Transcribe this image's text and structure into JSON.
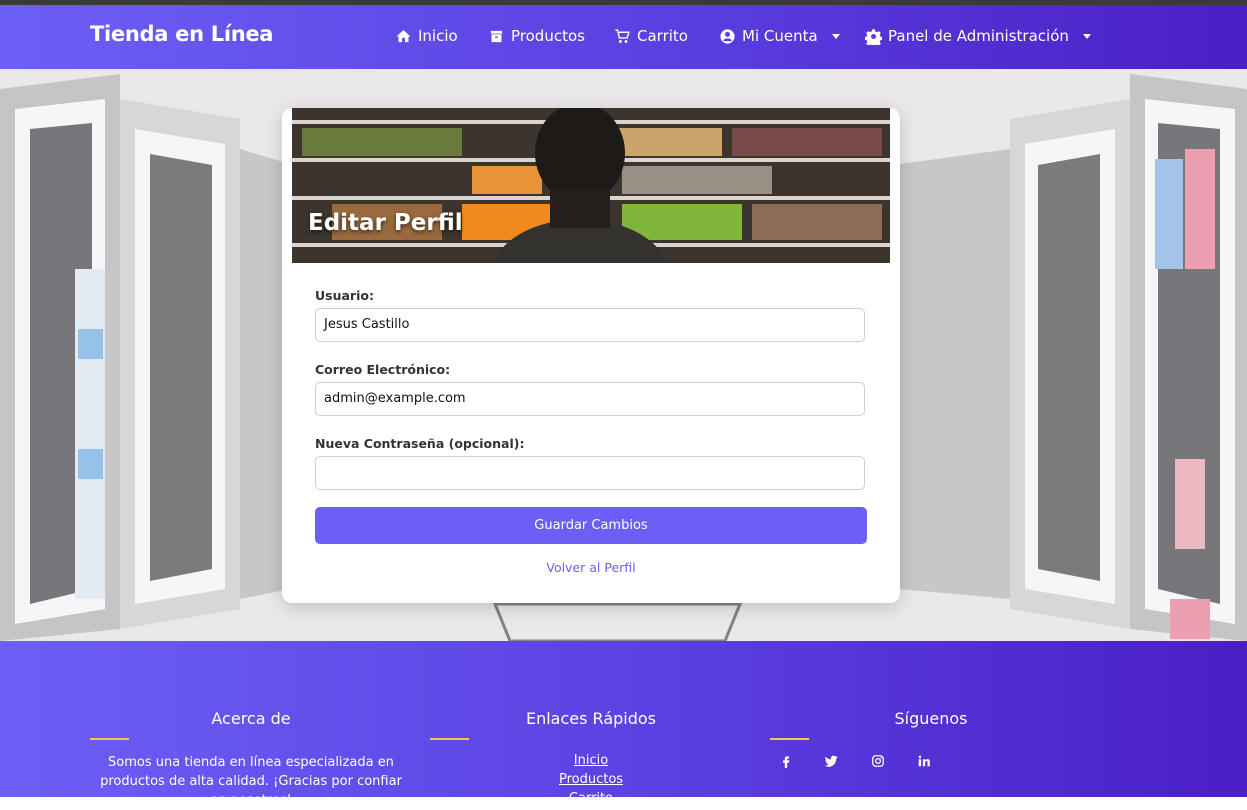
{
  "nav": {
    "brand": "Tienda en Línea",
    "items": [
      {
        "label": "Inicio",
        "icon": "home-icon"
      },
      {
        "label": "Productos",
        "icon": "box-icon"
      },
      {
        "label": "Carrito",
        "icon": "cart-icon"
      },
      {
        "label": "Mi Cuenta",
        "icon": "user-circle-icon"
      },
      {
        "label": "Panel de Administración",
        "icon": "gear-icon"
      }
    ]
  },
  "card": {
    "title": "Editar Perfil",
    "fields": [
      {
        "label": "Usuario:",
        "value": "Jesus Castillo"
      },
      {
        "label": "Correo Electrónico:",
        "value": "admin@example.com"
      },
      {
        "label": "Nueva Contraseña (opcional):",
        "value": ""
      }
    ],
    "save_label": "Guardar Cambios",
    "back_label": "Volver al Perfil"
  },
  "footer": {
    "about_title": "Acerca de",
    "about_text": "Somos una tienda en línea especializada en productos de alta calidad. ¡Gracias por confiar en nosotros!",
    "links_title": "Enlaces Rápidos",
    "links": [
      "Inicio",
      "Productos",
      "Carrito"
    ],
    "social_title": "Síguenos",
    "social_icons": [
      "facebook-icon",
      "twitter-icon",
      "instagram-icon",
      "linkedin-icon"
    ]
  },
  "colors": {
    "accent": "#6c5ff6",
    "accent_dark": "#4a1fc4",
    "underline": "#f4c84b"
  }
}
